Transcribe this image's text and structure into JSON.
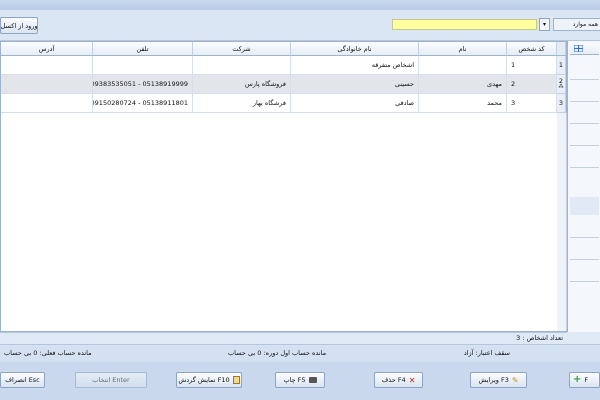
{
  "toolbar": {
    "import_label": "ورود از اکسل",
    "filter_label": "همه موارد",
    "search_value": "",
    "filter_arrow": "▾"
  },
  "table": {
    "columns": [
      "کد شخص",
      "نام",
      "نام خانوادگی",
      "شرکت",
      "تلفن",
      "آدرس"
    ],
    "rows": [
      {
        "row_no": "1",
        "code": "1",
        "first_name": "",
        "last_name": "اشخاص متفرقه",
        "company": "",
        "phone": "",
        "address": ""
      },
      {
        "row_no": "2",
        "code": "2",
        "first_name": "مهدی",
        "last_name": "حسینی",
        "company": "فروشگاه پارس",
        "phone": "09383535051 - 05138919999",
        "address": "",
        "marker": "⁂"
      },
      {
        "row_no": "3",
        "code": "3",
        "first_name": "محمد",
        "last_name": "صادقی",
        "company": "فرشگاه بهار",
        "phone": "09150280724 - 05138911801",
        "address": ""
      }
    ]
  },
  "status": {
    "count_label": "تعداد اشخاص : 3",
    "credit_limit": "سقف اعتبار: آزاد",
    "opening_balance": "مانده حساب اول دوره: 0 بی حساب",
    "current_balance": "مانده حساب فعلی: 0 بی حساب"
  },
  "buttons": {
    "add": "F",
    "edit": "ویرایش F3",
    "delete": "حذف F4",
    "print": "چاپ F5",
    "turnover": "نمایش گردش F10",
    "select": "انتخاب Enter",
    "cancel": "انصراف Esc"
  },
  "colors": {
    "accent": "#dbe6f4",
    "search_bg": "#ffffa0",
    "delete_icon": "#d42020",
    "add_icon": "#2ea02e"
  }
}
